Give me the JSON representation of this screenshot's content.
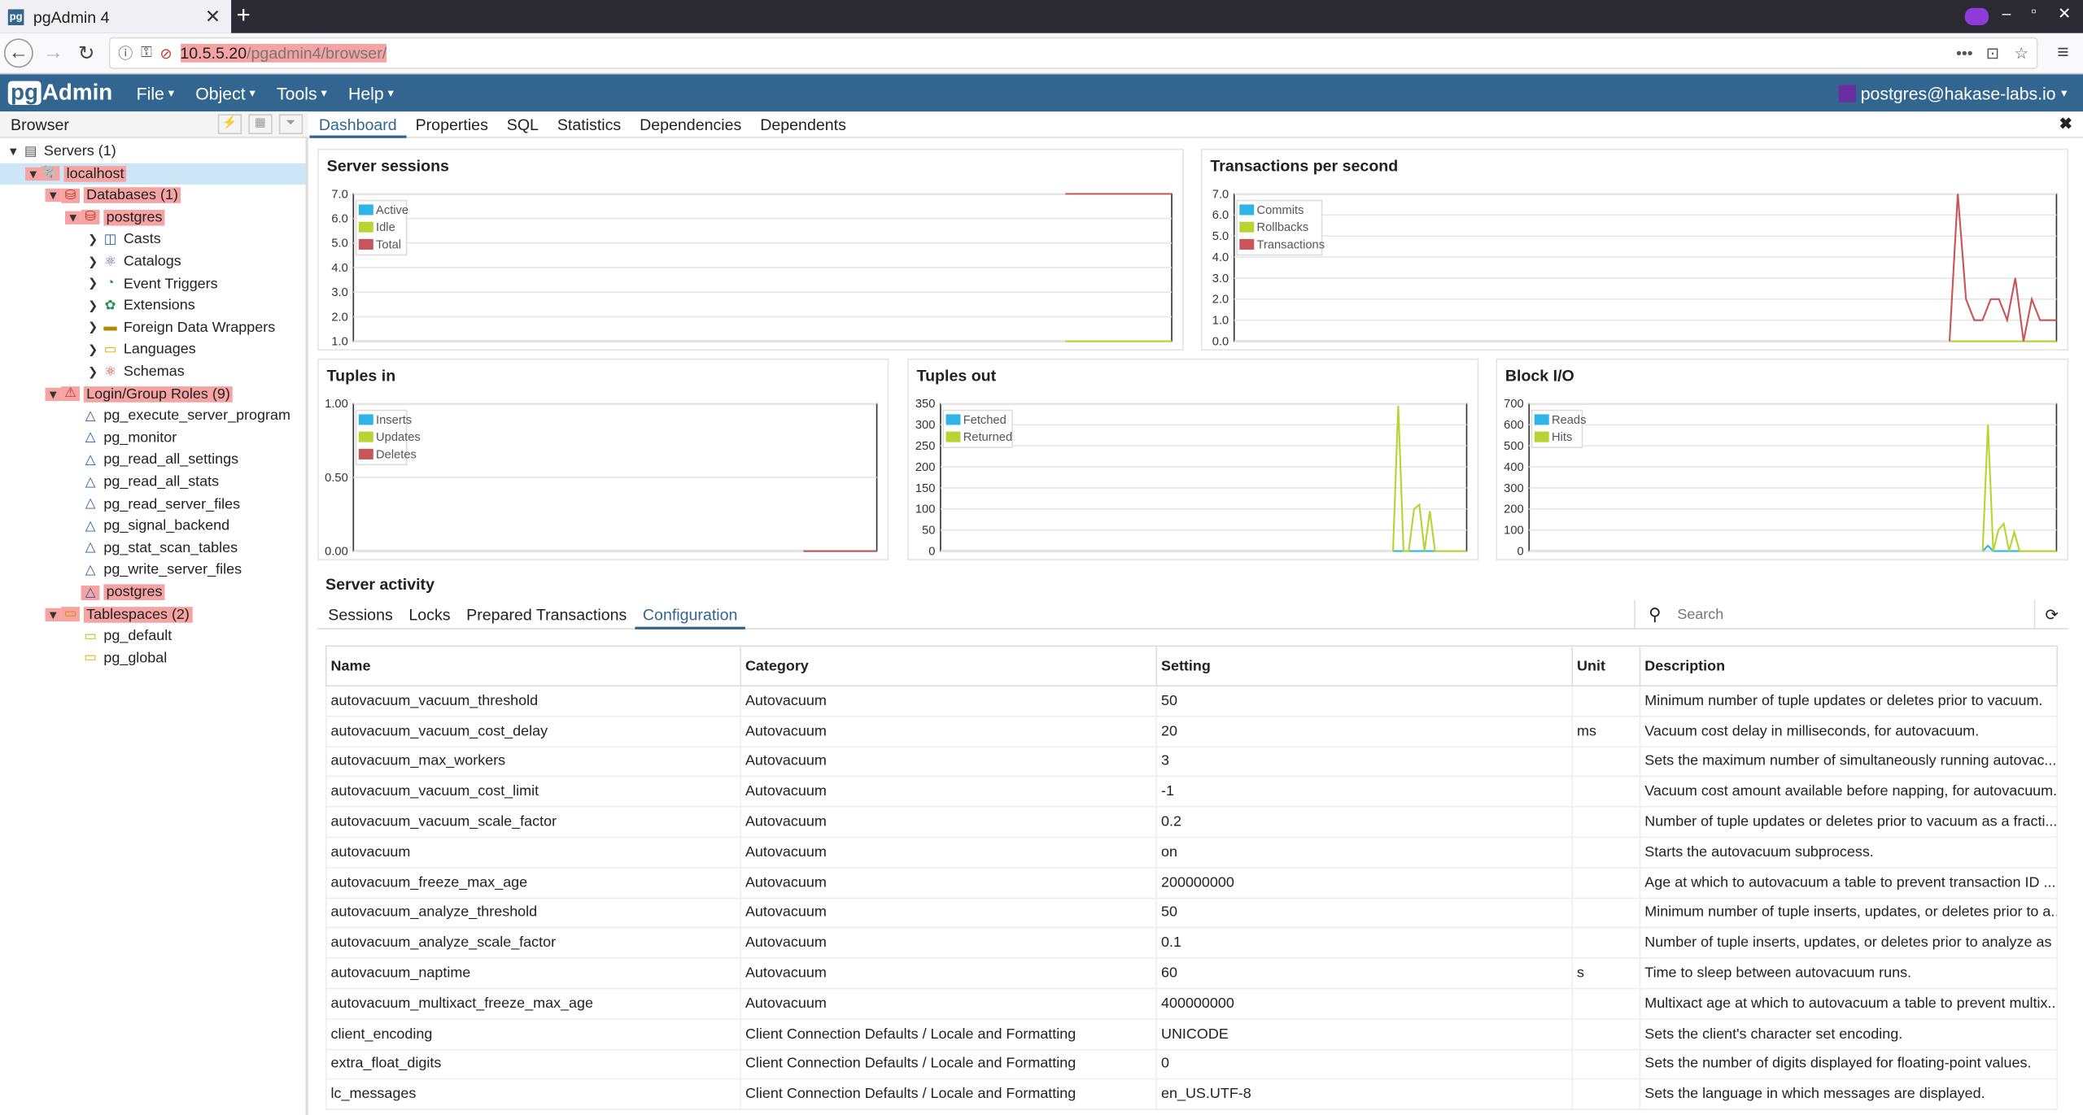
{
  "browser": {
    "tab_title": "pgAdmin 4",
    "url_host": "10.5.5.20",
    "url_path": "/pgadmin4/browser/"
  },
  "nav": {
    "logo_pg": "pg",
    "logo_admin": "Admin",
    "menus": [
      "File",
      "Object",
      "Tools",
      "Help"
    ],
    "user": "postgres@hakase-labs.io"
  },
  "sidebar": {
    "title": "Browser",
    "tree": [
      {
        "label": "Servers (1)",
        "level": 0,
        "toggle": "v",
        "icon": "servers-icon"
      },
      {
        "label": "localhost",
        "level": 1,
        "toggle": "v",
        "icon": "server-icon",
        "highlight": true
      },
      {
        "label": "Databases (1)",
        "level": 2,
        "toggle": "v",
        "icon": "databases-icon",
        "highlight": true
      },
      {
        "label": "postgres",
        "level": 3,
        "toggle": "v",
        "icon": "database-icon",
        "highlight": true
      },
      {
        "label": "Casts",
        "level": 4,
        "toggle": ">",
        "icon": "casts-icon"
      },
      {
        "label": "Catalogs",
        "level": 4,
        "toggle": ">",
        "icon": "catalogs-icon"
      },
      {
        "label": "Event Triggers",
        "level": 4,
        "toggle": ">",
        "icon": "event-triggers-icon"
      },
      {
        "label": "Extensions",
        "level": 4,
        "toggle": ">",
        "icon": "extensions-icon"
      },
      {
        "label": "Foreign Data Wrappers",
        "level": 4,
        "toggle": ">",
        "icon": "fdw-icon"
      },
      {
        "label": "Languages",
        "level": 4,
        "toggle": ">",
        "icon": "languages-icon"
      },
      {
        "label": "Schemas",
        "level": 4,
        "toggle": ">",
        "icon": "schemas-icon"
      },
      {
        "label": "Login/Group Roles (9)",
        "level": 2,
        "toggle": "v",
        "icon": "roles-icon",
        "highlight": true
      },
      {
        "label": "pg_execute_server_program",
        "level": 3,
        "toggle": "",
        "icon": "role-icon"
      },
      {
        "label": "pg_monitor",
        "level": 3,
        "toggle": "",
        "icon": "role-icon"
      },
      {
        "label": "pg_read_all_settings",
        "level": 3,
        "toggle": "",
        "icon": "role-icon"
      },
      {
        "label": "pg_read_all_stats",
        "level": 3,
        "toggle": "",
        "icon": "role-icon"
      },
      {
        "label": "pg_read_server_files",
        "level": 3,
        "toggle": "",
        "icon": "role-icon"
      },
      {
        "label": "pg_signal_backend",
        "level": 3,
        "toggle": "",
        "icon": "role-icon"
      },
      {
        "label": "pg_stat_scan_tables",
        "level": 3,
        "toggle": "",
        "icon": "role-icon"
      },
      {
        "label": "pg_write_server_files",
        "level": 3,
        "toggle": "",
        "icon": "role-icon"
      },
      {
        "label": "postgres",
        "level": 3,
        "toggle": "",
        "icon": "role-icon",
        "highlight": true
      },
      {
        "label": "Tablespaces (2)",
        "level": 2,
        "toggle": "v",
        "icon": "tablespaces-icon",
        "highlight": true
      },
      {
        "label": "pg_default",
        "level": 3,
        "toggle": "",
        "icon": "tablespace-icon"
      },
      {
        "label": "pg_global",
        "level": 3,
        "toggle": "",
        "icon": "tablespace-icon"
      }
    ]
  },
  "main_tabs": [
    "Dashboard",
    "Properties",
    "SQL",
    "Statistics",
    "Dependencies",
    "Dependents"
  ],
  "colors": {
    "blue": "#2fb4e8",
    "green": "#b8d432",
    "red": "#c8555a",
    "brand": "#326690"
  },
  "chart_data": [
    {
      "id": "sessions",
      "type": "line",
      "title": "Server sessions",
      "ylim": [
        1.0,
        7.0
      ],
      "yticks": [
        "1.0",
        "2.0",
        "3.0",
        "4.0",
        "5.0",
        "6.0",
        "7.0"
      ],
      "series": [
        {
          "name": "Active",
          "color": "#2fb4e8",
          "values": [
            1,
            1,
            1,
            1,
            1,
            1,
            1,
            1,
            1,
            1,
            1,
            1,
            1,
            1,
            1,
            1,
            1,
            1,
            1,
            1
          ]
        },
        {
          "name": "Idle",
          "color": "#b8d432",
          "values": [
            1,
            1,
            1,
            1,
            1,
            1,
            1,
            1,
            1,
            1,
            1,
            1,
            1,
            1,
            1,
            1,
            1,
            1,
            1,
            1
          ]
        },
        {
          "name": "Total",
          "color": "#c8555a",
          "values": [
            7,
            7,
            7,
            7,
            7,
            7,
            7,
            7,
            7,
            7,
            7,
            7,
            7,
            7,
            7,
            7,
            7,
            7,
            7,
            7
          ]
        }
      ]
    },
    {
      "id": "tps",
      "type": "line",
      "title": "Transactions per second",
      "ylim": [
        0.0,
        7.0
      ],
      "yticks": [
        "0.0",
        "1.0",
        "2.0",
        "3.0",
        "4.0",
        "5.0",
        "6.0",
        "7.0"
      ],
      "series": [
        {
          "name": "Commits",
          "color": "#2fb4e8",
          "values": [
            0,
            0,
            0,
            0,
            0,
            0,
            0,
            0,
            0,
            0,
            0,
            0,
            0,
            0,
            0,
            0,
            0,
            0,
            0,
            0
          ]
        },
        {
          "name": "Rollbacks",
          "color": "#b8d432",
          "values": [
            0,
            0,
            0,
            0,
            0,
            0,
            0,
            0,
            0,
            0,
            0,
            0,
            0,
            0,
            0,
            0,
            0,
            0,
            0,
            0
          ]
        },
        {
          "name": "Transactions",
          "color": "#c8555a",
          "values": [
            0,
            7,
            2,
            1,
            1,
            2,
            2,
            1,
            3,
            0,
            2,
            1,
            1,
            1
          ]
        }
      ]
    },
    {
      "id": "tin",
      "type": "line",
      "title": "Tuples in",
      "ylim": [
        0,
        1
      ],
      "yticks": [
        "0.00",
        "0.50",
        "1.00"
      ],
      "series": [
        {
          "name": "Inserts",
          "color": "#2fb4e8",
          "values": [
            0,
            0,
            0,
            0,
            0,
            0
          ]
        },
        {
          "name": "Updates",
          "color": "#b8d432",
          "values": [
            0,
            0,
            0,
            0,
            0,
            0
          ]
        },
        {
          "name": "Deletes",
          "color": "#c8555a",
          "values": [
            0,
            0,
            0,
            0,
            0,
            0
          ]
        }
      ]
    },
    {
      "id": "tout",
      "type": "line",
      "title": "Tuples out",
      "ylim": [
        0,
        350
      ],
      "yticks": [
        "0",
        "50",
        "100",
        "150",
        "200",
        "250",
        "300",
        "350"
      ],
      "series": [
        {
          "name": "Fetched",
          "color": "#2fb4e8",
          "values": [
            0,
            0,
            0,
            0,
            0,
            0,
            0,
            0,
            0,
            0,
            0,
            0,
            0,
            0,
            0
          ]
        },
        {
          "name": "Returned",
          "color": "#b8d432",
          "values": [
            0,
            345,
            0,
            0,
            100,
            110,
            0,
            95,
            0,
            0,
            0,
            0,
            0,
            0,
            0
          ]
        }
      ]
    },
    {
      "id": "bio",
      "type": "line",
      "title": "Block I/O",
      "ylim": [
        0,
        700
      ],
      "yticks": [
        "0",
        "100",
        "200",
        "300",
        "400",
        "500",
        "600",
        "700"
      ],
      "series": [
        {
          "name": "Reads",
          "color": "#2fb4e8",
          "values": [
            0,
            25,
            0,
            0,
            0,
            0,
            0,
            0,
            0,
            0,
            0,
            0,
            0,
            0,
            0
          ]
        },
        {
          "name": "Hits",
          "color": "#b8d432",
          "values": [
            0,
            600,
            0,
            100,
            130,
            0,
            90,
            0,
            0,
            0,
            0,
            0,
            0,
            0,
            0
          ]
        }
      ]
    }
  ],
  "activity": {
    "title": "Server activity",
    "tabs": [
      "Sessions",
      "Locks",
      "Prepared Transactions",
      "Configuration"
    ],
    "search_placeholder": "Search",
    "columns": [
      "Name",
      "Category",
      "Setting",
      "Unit",
      "Description"
    ],
    "rows": [
      [
        "autovacuum_vacuum_threshold",
        "Autovacuum",
        "50",
        "",
        "Minimum number of tuple updates or deletes prior to vacuum."
      ],
      [
        "autovacuum_vacuum_cost_delay",
        "Autovacuum",
        "20",
        "ms",
        "Vacuum cost delay in milliseconds, for autovacuum."
      ],
      [
        "autovacuum_max_workers",
        "Autovacuum",
        "3",
        "",
        "Sets the maximum number of simultaneously running autovac..."
      ],
      [
        "autovacuum_vacuum_cost_limit",
        "Autovacuum",
        "-1",
        "",
        "Vacuum cost amount available before napping, for autovacuum."
      ],
      [
        "autovacuum_vacuum_scale_factor",
        "Autovacuum",
        "0.2",
        "",
        "Number of tuple updates or deletes prior to vacuum as a fracti..."
      ],
      [
        "autovacuum",
        "Autovacuum",
        "on",
        "",
        "Starts the autovacuum subprocess."
      ],
      [
        "autovacuum_freeze_max_age",
        "Autovacuum",
        "200000000",
        "",
        "Age at which to autovacuum a table to prevent transaction ID ..."
      ],
      [
        "autovacuum_analyze_threshold",
        "Autovacuum",
        "50",
        "",
        "Minimum number of tuple inserts, updates, or deletes prior to a..."
      ],
      [
        "autovacuum_analyze_scale_factor",
        "Autovacuum",
        "0.1",
        "",
        "Number of tuple inserts, updates, or deletes prior to analyze as ..."
      ],
      [
        "autovacuum_naptime",
        "Autovacuum",
        "60",
        "s",
        "Time to sleep between autovacuum runs."
      ],
      [
        "autovacuum_multixact_freeze_max_age",
        "Autovacuum",
        "400000000",
        "",
        "Multixact age at which to autovacuum a table to prevent multix..."
      ],
      [
        "client_encoding",
        "Client Connection Defaults / Locale and Formatting",
        "UNICODE",
        "",
        "Sets the client's character set encoding."
      ],
      [
        "extra_float_digits",
        "Client Connection Defaults / Locale and Formatting",
        "0",
        "",
        "Sets the number of digits displayed for floating-point values."
      ],
      [
        "lc_messages",
        "Client Connection Defaults / Locale and Formatting",
        "en_US.UTF-8",
        "",
        "Sets the language in which messages are displayed."
      ]
    ]
  }
}
